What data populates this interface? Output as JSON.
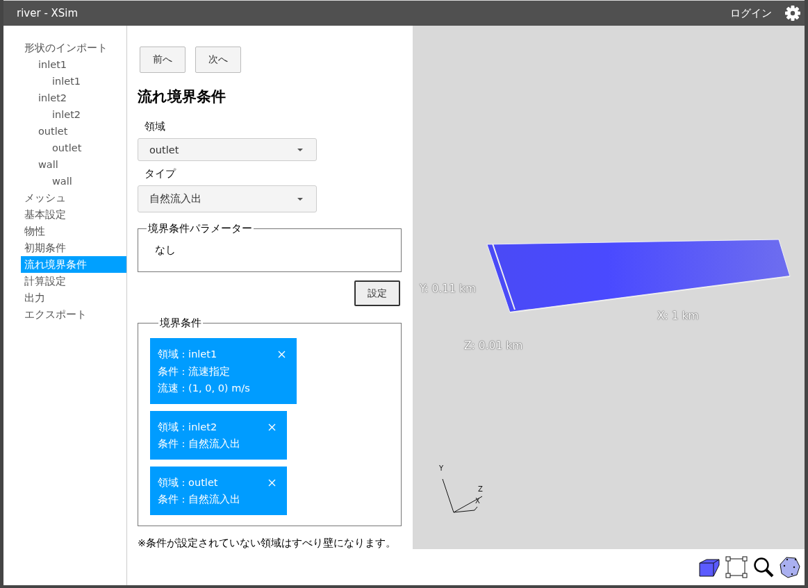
{
  "window": {
    "title": "river - XSim"
  },
  "header": {
    "login": "ログイン"
  },
  "sidebar": {
    "items": [
      {
        "label": "形状のインポート",
        "selected": false,
        "children": [
          {
            "label": "inlet1",
            "selected": false,
            "children": [
              {
                "label": "inlet1",
                "selected": false
              }
            ]
          },
          {
            "label": "inlet2",
            "selected": false,
            "children": [
              {
                "label": "inlet2",
                "selected": false
              }
            ]
          },
          {
            "label": "outlet",
            "selected": false,
            "children": [
              {
                "label": "outlet",
                "selected": false
              }
            ]
          },
          {
            "label": "wall",
            "selected": false,
            "children": [
              {
                "label": "wall",
                "selected": false
              }
            ]
          }
        ]
      },
      {
        "label": "メッシュ",
        "selected": false
      },
      {
        "label": "基本設定",
        "selected": false
      },
      {
        "label": "物性",
        "selected": false
      },
      {
        "label": "初期条件",
        "selected": false
      },
      {
        "label": "流れ境界条件",
        "selected": true
      },
      {
        "label": "計算設定",
        "selected": false
      },
      {
        "label": "出力",
        "selected": false
      },
      {
        "label": "エクスポート",
        "selected": false
      }
    ]
  },
  "nav": {
    "buttons": [
      "前へ",
      "次へ"
    ]
  },
  "form": {
    "title": "流れ境界条件",
    "fields": [
      {
        "label": "領域",
        "value": "outlet"
      },
      {
        "label": "タイプ",
        "value": "自然流入出"
      }
    ],
    "params": {
      "legend": "境界条件パラメーター",
      "text": "なし"
    },
    "set_button": "設定",
    "conditions": {
      "legend": "境界条件",
      "cards": [
        {
          "lines": [
            "領域 : inlet1",
            "条件 : 流速指定",
            "流速 : (1, 0, 0) m/s"
          ]
        },
        {
          "lines": [
            "領域 : inlet2",
            "条件 : 自然流入出"
          ]
        },
        {
          "lines": [
            "領域 : outlet",
            "条件 : 自然流入出"
          ]
        }
      ]
    },
    "note": "※条件が設定されていない領域はすべり壁になります。"
  },
  "viewport": {
    "dimensions": {
      "y": "Y: 0.11 km",
      "x": "X: 1 km",
      "z": "Z: 0.01 km"
    },
    "axes": {
      "y": "Y",
      "z": "Z",
      "x": "X"
    }
  }
}
